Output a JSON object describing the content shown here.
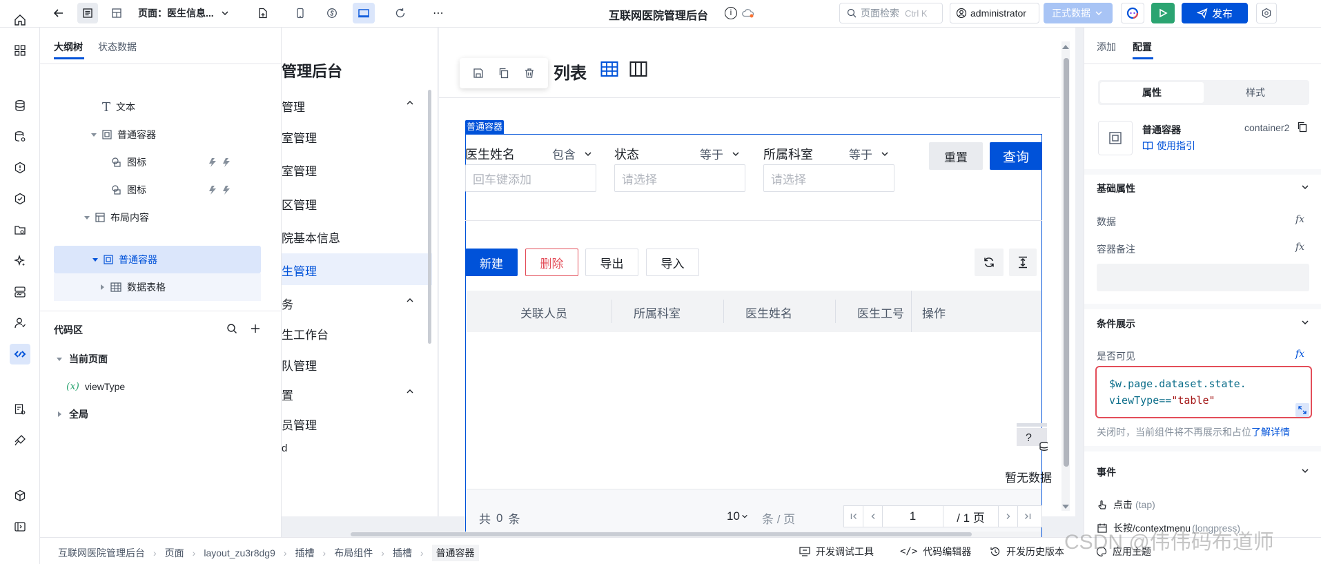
{
  "topbar": {
    "page_label": "页面：医生信息...",
    "app_title": "互联网医院管理后台",
    "search_placeholder": "页面检索",
    "search_shortcut": "Ctrl K",
    "user": "administrator",
    "env": "正式数据",
    "publish": "发布"
  },
  "outline": {
    "tabs": [
      "大纲树",
      "状态数据"
    ],
    "nodes": [
      {
        "label": "文本"
      },
      {
        "label": "普通容器"
      },
      {
        "label": "图标"
      },
      {
        "label": "图标"
      },
      {
        "label": "布局内容"
      },
      {
        "label": "普通容器"
      },
      {
        "label": "数据表格"
      }
    ],
    "code_title": "代码区",
    "current_page": "当前页面",
    "var_prefix": "(x)",
    "var_name": "viewType",
    "global": "全局"
  },
  "nav": {
    "title": "管理后台",
    "items": [
      "管理",
      "室管理",
      "室管理",
      "区管理",
      "院基本信息",
      "生管理",
      "务",
      "生工作台",
      "队管理",
      "置",
      "员管理",
      "d"
    ]
  },
  "page": {
    "title": "列表",
    "container_tag": "普通容器",
    "filters": [
      {
        "label": "医生姓名",
        "op": "包含",
        "placeholder": "回车键添加"
      },
      {
        "label": "状态",
        "op": "等于",
        "placeholder": "请选择"
      },
      {
        "label": "所属科室",
        "op": "等于",
        "placeholder": "请选择"
      }
    ],
    "reset": "重置",
    "query": "查询",
    "actions": {
      "create": "新建",
      "delete": "删除",
      "export": "导出",
      "import": "导入"
    },
    "columns": [
      "关联人员",
      "所属科室",
      "医生姓名",
      "医生工号",
      "操作"
    ],
    "empty": "暂无数据",
    "empty_icon_char": "?",
    "total_prefix": "共",
    "total": "0",
    "total_suffix": "条",
    "page_size": "10",
    "page_size_unit": "条 / 页",
    "page_input": "1",
    "page_total": "/ 1 页"
  },
  "right": {
    "tabs": [
      "添加",
      "配置"
    ],
    "subtabs": [
      "属性",
      "样式"
    ],
    "comp_name": "普通容器",
    "comp_id": "container2",
    "guide": "使用指引",
    "basic_title": "基础属性",
    "prop_data": "数据",
    "prop_note": "容器备注",
    "fx": "fx",
    "cond_title": "条件展示",
    "visible_label": "是否可见",
    "code_line1": "$w.page.dataset.state.",
    "code_line2a": "viewType==",
    "code_line2b": "\"table\"",
    "hint": "关闭时，当前组件将不再展示和占位",
    "hint_link": "了解详情",
    "events_title": "事件",
    "event1": "点击",
    "event1_sub": "(tap)",
    "event2": "长按/contextmenu",
    "event2_sub": "(longpress)",
    "apply_theme": "应用主题"
  },
  "statusbar": {
    "crumbs": [
      "互联网医院管理后台",
      "页面",
      "layout_zu3r8dg9",
      "插槽",
      "布局组件",
      "插槽",
      "普通容器"
    ],
    "tools": [
      "开发调试工具",
      "代码编辑器",
      "开发历史版本"
    ]
  },
  "watermark": "CSDN @伟伟码布道师",
  "colors": {
    "primary": "#0052d9",
    "danger": "#e34d59",
    "green": "#2ba471",
    "selected": "#dbe6fb"
  }
}
